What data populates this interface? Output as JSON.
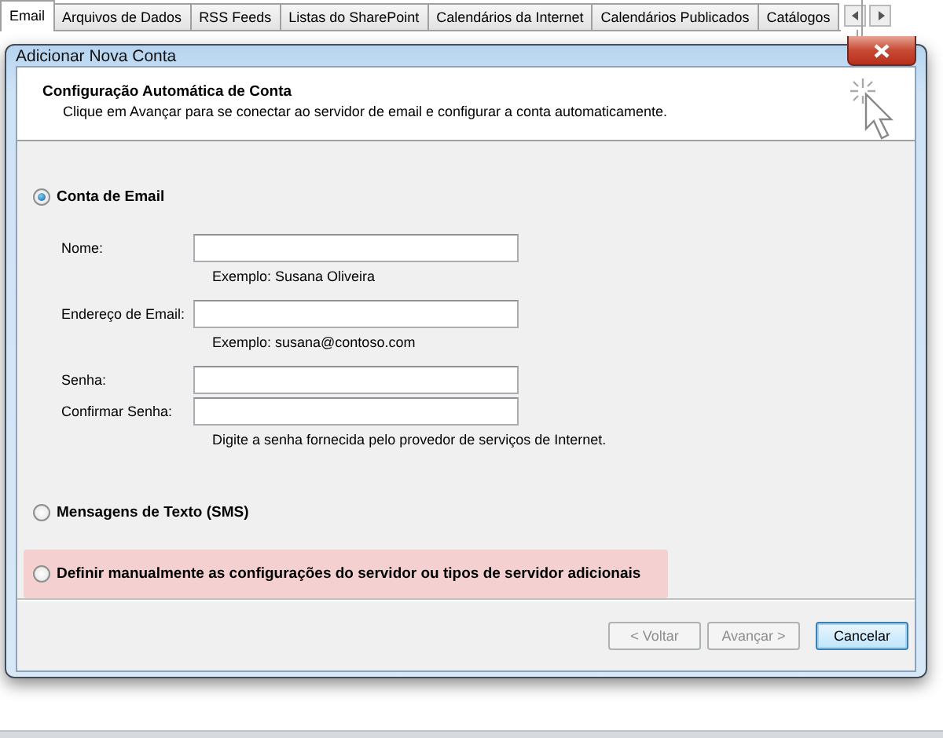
{
  "background_window": {
    "tabs": [
      {
        "label": "Email",
        "selected": true
      },
      {
        "label": "Arquivos de Dados",
        "selected": false
      },
      {
        "label": "RSS Feeds",
        "selected": false
      },
      {
        "label": "Listas do SharePoint",
        "selected": false
      },
      {
        "label": "Calendários da Internet",
        "selected": false
      },
      {
        "label": "Calendários Publicados",
        "selected": false
      },
      {
        "label": "Catálogos",
        "selected": false
      }
    ]
  },
  "dialog": {
    "title": "Adicionar Nova Conta",
    "header": {
      "title": "Configuração Automática de Conta",
      "subtitle": "Clique em Avançar para se conectar ao servidor de email e configurar a conta automaticamente."
    },
    "options": [
      {
        "label": "Conta de Email",
        "selected": true,
        "highlighted": false,
        "fields": [
          {
            "label": "Nome:",
            "hint": "Exemplo: Susana Oliveira"
          },
          {
            "label": "Endereço de Email:",
            "hint": "Exemplo: susana@contoso.com"
          },
          {
            "label": "Senha:"
          },
          {
            "label": "Confirmar Senha:",
            "hint": "Digite a senha fornecida pelo provedor de serviços de Internet."
          }
        ]
      },
      {
        "label": "Mensagens de Texto (SMS)",
        "selected": false,
        "highlighted": false
      },
      {
        "label": "Definir manualmente as configurações do servidor ou tipos de servidor adicionais",
        "selected": false,
        "highlighted": true
      }
    ],
    "buttons": [
      {
        "label": "< Voltar",
        "disabled": true,
        "default": false
      },
      {
        "label": "Avançar >",
        "disabled": true,
        "default": false
      },
      {
        "label": "Cancelar",
        "disabled": false,
        "default": true
      }
    ]
  }
}
